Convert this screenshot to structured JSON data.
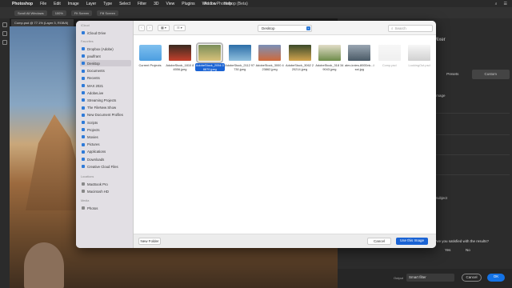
{
  "menubar": {
    "app": "Photoshop",
    "items": [
      "File",
      "Edit",
      "Image",
      "Layer",
      "Type",
      "Select",
      "Filter",
      "3D",
      "View",
      "Plugins",
      "Window",
      "Help"
    ],
    "window_title": "Adobe Photoshop (Beta)"
  },
  "options_bar": {
    "buttons": [
      "Scroll All Windows",
      "100%",
      "Fit Screen",
      "Fill Screen"
    ]
  },
  "document_tab": "Comp.psd @ 77.1% (Layer 3, RGB/8)",
  "right_panel": {
    "title": "Mixer",
    "tabs": [
      "Presets",
      "Custom"
    ],
    "image_option": "Image",
    "subject_label": "Subject",
    "question": "Are you satisfied with the results?",
    "yes": "Yes",
    "no": "No",
    "output_label": "Output",
    "output_value": "Smart filter",
    "cancel": "Cancel",
    "ok": "OK"
  },
  "dialog": {
    "location": "Desktop",
    "search_placeholder": "Search",
    "sidebar": {
      "cloud_header": "iCloud",
      "icloud": "iCloud Drive",
      "favorites_header": "Favorites",
      "items": [
        "Dropbox (Adobe)",
        "paulfrant",
        "Desktop",
        "Documents",
        "Recents",
        "MAX 2021",
        "AdobeLive",
        "Streaming Projects",
        "The FileNew Show",
        "New Document Profiles",
        "Scripts",
        "Projects",
        "Movies",
        "Pictures",
        "Applications",
        "Downloads",
        "Creative Cloud Files"
      ],
      "locations_header": "Locations",
      "locations": [
        "MacBook Pro",
        "Macintosh HD"
      ],
      "media_header": "Media",
      "media": [
        "Photos"
      ]
    },
    "files": [
      {
        "name": "Current Projects",
        "kind": "folder"
      },
      {
        "name": "AdobeStock_1810 84556.jpeg",
        "colors": [
          "#3a2a20",
          "#c4402c"
        ]
      },
      {
        "name": "AdobeStock_2094 08870.jpeg",
        "colors": [
          "#7a8e5a",
          "#d8c27a"
        ],
        "selected": true
      },
      {
        "name": "AdobeStock_2112 97730.jpeg",
        "colors": [
          "#2c6ea8",
          "#8fbfdd"
        ]
      },
      {
        "name": "AdobeStock_3000 423862.jpeg",
        "colors": [
          "#7a90b8",
          "#d06a3a"
        ]
      },
      {
        "name": "AdobeStock_3062 220214.jpeg",
        "colors": [
          "#3b4a2a",
          "#d2a44e"
        ]
      },
      {
        "name": "AdobeStock_318 349043.jpeg",
        "colors": [
          "#e2ddc8",
          "#6e8c4a"
        ]
      },
      {
        "name": "alex-knies-800Dnk...lsst.jpg",
        "colors": [
          "#9aa6b2",
          "#4a5a66"
        ]
      },
      {
        "name": "Comp.psd",
        "colors": [
          "#eeeeee",
          "#dddddd"
        ],
        "dim": true
      },
      {
        "name": "LookingOut.psd",
        "colors": [
          "#eeeeee",
          "#999999"
        ],
        "dim": true
      }
    ],
    "new_folder": "New Folder",
    "cancel": "Cancel",
    "use_button": "Use this Image"
  }
}
